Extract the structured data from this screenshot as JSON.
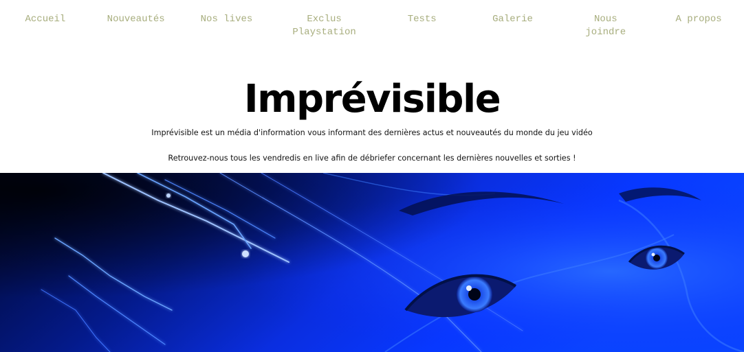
{
  "nav": {
    "items": [
      {
        "label": "Accueil"
      },
      {
        "label": "Nouveautés"
      },
      {
        "label": "Nos lives"
      },
      {
        "label": "Exclus Playstation"
      },
      {
        "label": "Tests"
      },
      {
        "label": "Galerie"
      },
      {
        "label": "Nous joindre"
      },
      {
        "label": "A propos"
      }
    ]
  },
  "hero": {
    "title": "Imprévisible",
    "description_1": "Imprévisible est un média d'information vous informant des dernières actus et nouveautés du monde du jeu vidéo",
    "description_2": "Retrouvez-nous tous les vendredis en live afin de débriefer concernant les dernières nouvelles et sorties !"
  },
  "colors": {
    "nav_text": "#a7ad7d",
    "title": "#000000",
    "banner_primary": "#0a2bff",
    "banner_dark": "#000a3a"
  }
}
